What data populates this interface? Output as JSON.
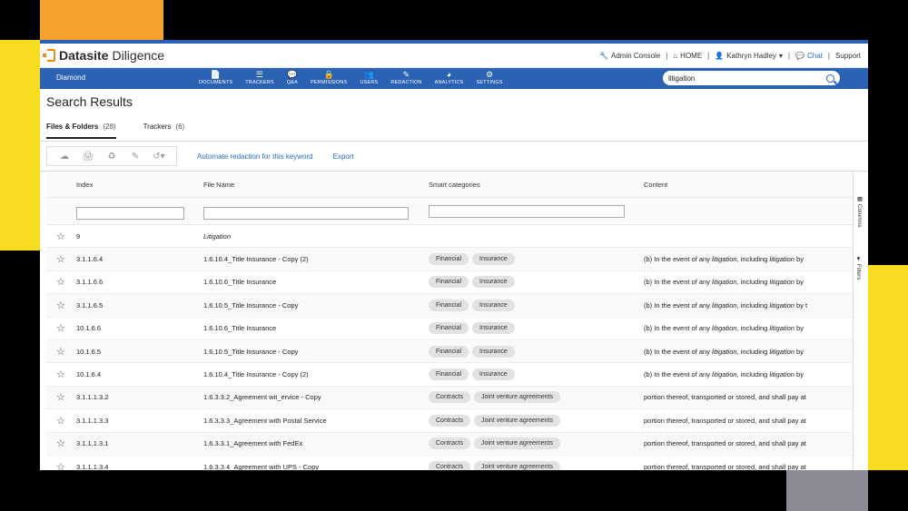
{
  "app": {
    "brand": "Datasite",
    "product": "Diligence"
  },
  "header": {
    "admin_console": "Admin Console",
    "home": "HOME",
    "user": "Kathryn Hadley",
    "chat": "Chat",
    "support": "Support"
  },
  "navbar": {
    "project": "Diamond",
    "items": [
      {
        "icon": "document-icon",
        "label": "DOCUMENTS"
      },
      {
        "icon": "trackers-icon",
        "label": "TRACKERS"
      },
      {
        "icon": "qa-icon",
        "label": "Q&A"
      },
      {
        "icon": "lock-icon",
        "label": "PERMISSIONS"
      },
      {
        "icon": "users-icon",
        "label": "USERS"
      },
      {
        "icon": "pen-icon",
        "label": "REDACTION"
      },
      {
        "icon": "pie-icon",
        "label": "ANALYTICS"
      },
      {
        "icon": "gear-icon",
        "label": "SETTINGS"
      }
    ],
    "search_value": "litigation"
  },
  "page": {
    "title": "Search Results",
    "tabs": [
      {
        "label": "Files & Folders",
        "count": "(28)"
      },
      {
        "label": "Trackers",
        "count": "(6)"
      }
    ]
  },
  "toolbar": {
    "automate_label": "Automate redaction for this keyword",
    "export_label": "Export"
  },
  "grid": {
    "columns": [
      "Index",
      "File Name",
      "Smart categories",
      "Content"
    ],
    "side_tabs": [
      "Columns",
      "Filters"
    ],
    "rows": [
      {
        "index": "9",
        "name": "Litigation",
        "cats": [],
        "pre": "",
        "kw1": "",
        "mid": "",
        "kw2": "",
        "post": ""
      },
      {
        "index": "3.1.1.6.4",
        "name": "1.6.10.4_Title Insurance - Copy (2)",
        "cats": [
          "Financial",
          "Insurance"
        ],
        "pre": "(b) In the event of any ",
        "kw1": "litigation",
        "mid": ", including ",
        "kw2": "litigation",
        "post": " by"
      },
      {
        "index": "3.1.1.6.6",
        "name": "1.6.10.6_Title Insurance",
        "cats": [
          "Financial",
          "Insurance"
        ],
        "pre": "(b) In the event of any ",
        "kw1": "litigation",
        "mid": ", including ",
        "kw2": "litigation",
        "post": " by"
      },
      {
        "index": "3.1.1.6.5",
        "name": "1.6.10.5_Title Insurance - Copy",
        "cats": [
          "Financial",
          "Insurance"
        ],
        "pre": "(b) In the event of any ",
        "kw1": "litigation",
        "mid": ", including ",
        "kw2": "litigation",
        "post": " by t"
      },
      {
        "index": "10.1.6.6",
        "name": "1.6.10.6_Title Insurance",
        "cats": [
          "Financial",
          "Insurance"
        ],
        "pre": "(b) In the event of any ",
        "kw1": "litigation",
        "mid": ", including ",
        "kw2": "litigation",
        "post": " by"
      },
      {
        "index": "10.1.6.5",
        "name": "1.6.10.5_Title Insurance - Copy",
        "cats": [
          "Financial",
          "Insurance"
        ],
        "pre": "(b) In the event of any ",
        "kw1": "litigation",
        "mid": ", including ",
        "kw2": "litigation",
        "post": " by"
      },
      {
        "index": "10.1.6.4",
        "name": "1.6.10.4_Title Insurance - Copy (2)",
        "cats": [
          "Financial",
          "Insurance"
        ],
        "pre": "(b) In the event of any ",
        "kw1": "litigation",
        "mid": ", including ",
        "kw2": "litigation",
        "post": " by"
      },
      {
        "index": "3.1.1.1.3.2",
        "name": "1.6.3.3.2_Agreement wit_ervice - Copy",
        "cats": [
          "Contracts",
          "Joint venture agreements"
        ],
        "pre": "portion thereof, transported or stored, and shall pay at",
        "kw1": "",
        "mid": "",
        "kw2": "",
        "post": ""
      },
      {
        "index": "3.1.1.1.3.3",
        "name": "1.6.3.3.3_Agreement with Postal Service",
        "cats": [
          "Contracts",
          "Joint venture agreements"
        ],
        "pre": "portion thereof, transported or stored, and shall pay at",
        "kw1": "",
        "mid": "",
        "kw2": "",
        "post": ""
      },
      {
        "index": "3.1.1.1.3.1",
        "name": "1.6.3.3.1_Agreement with FedEx",
        "cats": [
          "Contracts",
          "Joint venture agreements"
        ],
        "pre": "portion thereof, transported or stored, and shall pay at",
        "kw1": "",
        "mid": "",
        "kw2": "",
        "post": ""
      },
      {
        "index": "3.1.1.1.3.4",
        "name": "1.6.3.3.4_Agreement with UPS - Copy",
        "cats": [
          "Contracts",
          "Joint venture agreements"
        ],
        "pre": "portion thereof, transported or stored, and shall pay at",
        "kw1": "",
        "mid": "",
        "kw2": "",
        "post": ""
      }
    ]
  },
  "colors": {
    "accent": "#2b62b3",
    "brand_orange": "#f08a1c"
  }
}
